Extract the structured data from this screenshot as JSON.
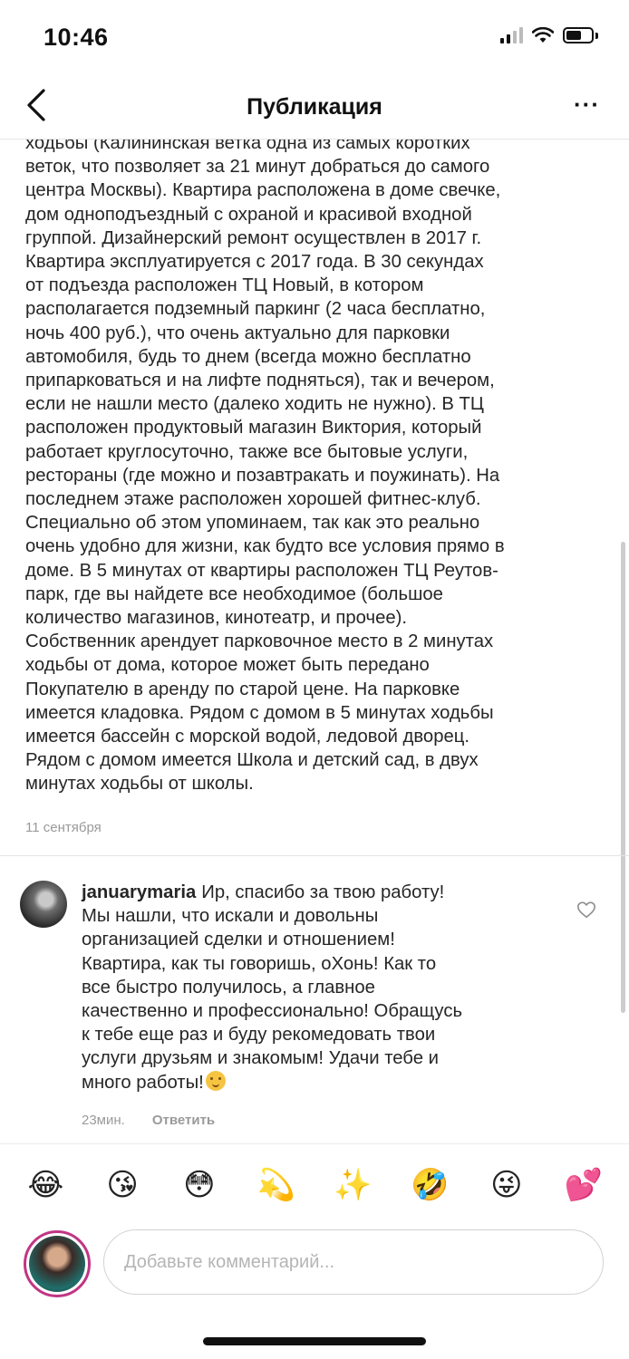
{
  "status_bar": {
    "time": "10:46"
  },
  "nav": {
    "title": "Публикация",
    "more_label": "···"
  },
  "post": {
    "caption": "ходьбы (Калининская ветка одна из самых коротких\nветок, что позволяет за 21 минут добраться до самого\nцентра Москвы). Квартира расположена в доме свечке,\nдом одноподъездный с охраной и красивой входной\nгруппой. Дизайнерский ремонт осуществлен в 2017 г.\nКвартира эксплуатируется с 2017 года. В 30 секундах\nот подъезда расположен ТЦ Новый, в котором\nрасполагается подземный паркинг (2 часа бесплатно,\nночь 400 руб.), что очень актуально для парковки\nавтомобиля, будь то днем (всегда можно бесплатно\nприпарковаться и на лифте подняться), так и вечером,\nесли не нашли место (далеко ходить не нужно). В ТЦ\nрасположен продуктовый магазин Виктория, который\nработает круглосуточно, также все  бытовые услуги,\nрестораны (где можно и позавтракать и поужинать). На\nпоследнем этаже расположен хорошей фитнес-клуб.\nСпециально об этом упоминаем, так как это реально\nочень удобно для жизни, как будто все условия прямо в\nдоме. В 5 минутах от квартиры расположен ТЦ Реутов-\nпарк, где вы найдете все необходимое (большое\nколичество магазинов, кинотеатр, и прочее).\nСобственник арендует парковочное место в 2 минутах\nходьбы от дома, которое может быть передано\nПокупателю в аренду по старой цене. На парковке\nимеется кладовка. Рядом с домом в 5 минутах ходьбы\nимеется бассейн с морской водой, ледовой дворец.\nРядом с домом имеется Школа и детский сад, в двух\nминутах ходьбы от школы.",
    "date": "11 сентября"
  },
  "comment": {
    "username": "januarymaria",
    "text": "Ир, спасибо за твою работу!\nМы нашли, что искали и довольны\nорганизацией сделки и отношением!\nКвартира, как ты говоришь, оХонь! Как то\nвсе быстро получилось, а главное\nкачественно и профессионально! Обращусь\nк тебе еще раз и буду рекомедовать твои\nуслуги друзьям и знакомым! Удачи тебе и\nмного работы!",
    "time": "23мин.",
    "reply_label": "Ответить"
  },
  "quick_emojis": [
    "😂",
    "😘",
    "😳",
    "💫",
    "✨",
    "🤣",
    "😜",
    "💕"
  ],
  "compose": {
    "placeholder": "Добавьте комментарий..."
  }
}
